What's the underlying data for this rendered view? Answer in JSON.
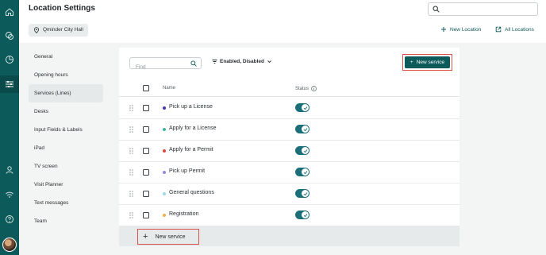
{
  "rail": {
    "icons": [
      "home-icon",
      "chat-icon",
      "analytics-icon",
      "settings-sliders-icon",
      "team-icon",
      "wifi-icon",
      "help-icon"
    ]
  },
  "header": {
    "title": "Location Settings",
    "location_chip": "Qminder City Hall",
    "search_placeholder": "",
    "new_location": "New Location",
    "all_locations": "All Locations"
  },
  "nav": {
    "items": [
      "General",
      "Opening hours",
      "Services (Lines)",
      "Desks",
      "Input Fields & Labels",
      "iPad",
      "TV screen",
      "Visit Planner",
      "Text messages",
      "Team"
    ],
    "active_index": 2
  },
  "toolbar": {
    "find_placeholder": "Find",
    "filter_label": "Enabled, Disabled",
    "new_service_label": "New service"
  },
  "table": {
    "columns": {
      "name": "Name",
      "status": "Status"
    },
    "rows": [
      {
        "name": "Pick up a License",
        "color": "#4a2fbf",
        "enabled": true
      },
      {
        "name": "Apply for a License",
        "color": "#3bb89c",
        "enabled": true
      },
      {
        "name": "Apply for a Permit",
        "color": "#e0443c",
        "enabled": true
      },
      {
        "name": "Pick up Permit",
        "color": "#9a86e0",
        "enabled": true
      },
      {
        "name": "General questions",
        "color": "#9fd8e8",
        "enabled": true
      },
      {
        "name": "Registration",
        "color": "#f0b04a",
        "enabled": true
      }
    ]
  },
  "footer": {
    "new_service_label": "New service"
  },
  "colors": {
    "accent": "#0d5a5a",
    "toggle_on": "#1b6f78",
    "highlight": "#d9534a"
  }
}
